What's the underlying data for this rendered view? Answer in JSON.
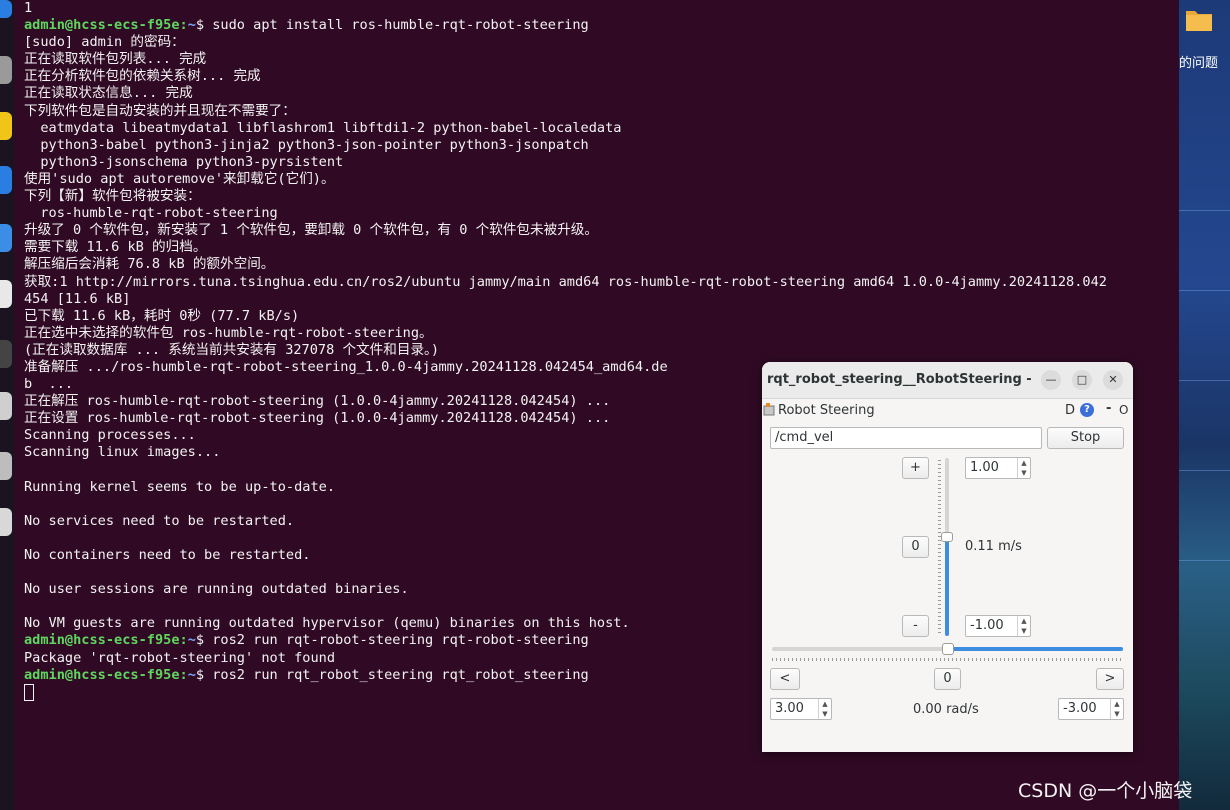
{
  "terminal": {
    "lines": [
      [
        {
          "t": "1"
        }
      ],
      [
        {
          "t": "admin@hcss-ecs-f95e",
          "c": "user"
        },
        {
          "t": ":",
          "c": ""
        },
        {
          "t": "~",
          "c": "path"
        },
        {
          "t": "$ sudo apt install ros-humble-rqt-robot-steering"
        }
      ],
      [
        {
          "t": "[sudo] admin 的密码："
        }
      ],
      [
        {
          "t": "正在读取软件包列表... 完成"
        }
      ],
      [
        {
          "t": "正在分析软件包的依赖关系树... 完成"
        }
      ],
      [
        {
          "t": "正在读取状态信息... 完成"
        }
      ],
      [
        {
          "t": "下列软件包是自动安装的并且现在不需要了："
        }
      ],
      [
        {
          "t": "  eatmydata libeatmydata1 libflashrom1 libftdi1-2 python-babel-localedata"
        }
      ],
      [
        {
          "t": "  python3-babel python3-jinja2 python3-json-pointer python3-jsonpatch"
        }
      ],
      [
        {
          "t": "  python3-jsonschema python3-pyrsistent"
        }
      ],
      [
        {
          "t": "使用'sudo apt autoremove'来卸载它(它们)。"
        }
      ],
      [
        {
          "t": "下列【新】软件包将被安装："
        }
      ],
      [
        {
          "t": "  ros-humble-rqt-robot-steering"
        }
      ],
      [
        {
          "t": "升级了 0 个软件包，新安装了 1 个软件包，要卸载 0 个软件包，有 0 个软件包未被升级。"
        }
      ],
      [
        {
          "t": "需要下载 11.6 kB 的归档。"
        }
      ],
      [
        {
          "t": "解压缩后会消耗 76.8 kB 的额外空间。"
        }
      ],
      [
        {
          "t": "获取:1 http://mirrors.tuna.tsinghua.edu.cn/ros2/ubuntu jammy/main amd64 ros-humble-rqt-robot-steering amd64 1.0.0-4jammy.20241128.042"
        }
      ],
      [
        {
          "t": "454 [11.6 kB]"
        }
      ],
      [
        {
          "t": "已下载 11.6 kB，耗时 0秒 (77.7 kB/s)"
        }
      ],
      [
        {
          "t": "正在选中未选择的软件包 ros-humble-rqt-robot-steering。"
        }
      ],
      [
        {
          "t": "(正在读取数据库 ... 系统当前共安装有 327078 个文件和目录。)"
        }
      ],
      [
        {
          "t": "准备解压 .../ros-humble-rqt-robot-steering_1.0.0-4jammy.20241128.042454_amd64.de"
        }
      ],
      [
        {
          "t": "b  ..."
        }
      ],
      [
        {
          "t": "正在解压 ros-humble-rqt-robot-steering (1.0.0-4jammy.20241128.042454) ..."
        }
      ],
      [
        {
          "t": "正在设置 ros-humble-rqt-robot-steering (1.0.0-4jammy.20241128.042454) ..."
        }
      ],
      [
        {
          "t": "Scanning processes..."
        }
      ],
      [
        {
          "t": "Scanning linux images..."
        }
      ],
      [
        {
          "t": ""
        }
      ],
      [
        {
          "t": "Running kernel seems to be up-to-date."
        }
      ],
      [
        {
          "t": ""
        }
      ],
      [
        {
          "t": "No services need to be restarted."
        }
      ],
      [
        {
          "t": ""
        }
      ],
      [
        {
          "t": "No containers need to be restarted."
        }
      ],
      [
        {
          "t": ""
        }
      ],
      [
        {
          "t": "No user sessions are running outdated binaries."
        }
      ],
      [
        {
          "t": ""
        }
      ],
      [
        {
          "t": "No VM guests are running outdated hypervisor (qemu) binaries on this host."
        }
      ],
      [
        {
          "t": "admin@hcss-ecs-f95e",
          "c": "user"
        },
        {
          "t": ":",
          "c": ""
        },
        {
          "t": "~",
          "c": "path"
        },
        {
          "t": "$ ros2 run rqt-robot-steering rqt-robot-steering"
        }
      ],
      [
        {
          "t": "Package 'rqt-robot-steering' not found"
        }
      ],
      [
        {
          "t": "admin@hcss-ecs-f95e",
          "c": "user"
        },
        {
          "t": ":",
          "c": ""
        },
        {
          "t": "~",
          "c": "path"
        },
        {
          "t": "$ ros2 run rqt_robot_steering rqt_robot_steering"
        }
      ]
    ]
  },
  "rqt": {
    "window_title": "rqt_robot_steering__RobotSteering - ...",
    "plugin_title": "Robot Steering",
    "plugin_d": "D",
    "plugin_help": "?",
    "plugin_minus": "-",
    "plugin_o": "O",
    "topic": "/cmd_vel",
    "stop_label": "Stop",
    "plus_label": "+",
    "minus_label": "-",
    "zero_label": "0",
    "left_label": "<",
    "right_label": ">",
    "max_linear": "1.00",
    "min_linear": "-1.00",
    "linear_readout": "0.11 m/s",
    "max_angular": "3.00",
    "min_angular": "-3.00",
    "angular_readout": "0.00 rad/s",
    "linear_value_fraction": 0.555,
    "angular_value_fraction": 0.5,
    "accent_color": "#3d8ee0"
  },
  "desktop": {
    "folder_label": "的问题"
  },
  "watermark": "CSDN @一个小脑袋",
  "colors": {
    "terminal_bg": "#300a24",
    "prompt_user": "#5fd75f",
    "prompt_path": "#7aa6ff"
  }
}
